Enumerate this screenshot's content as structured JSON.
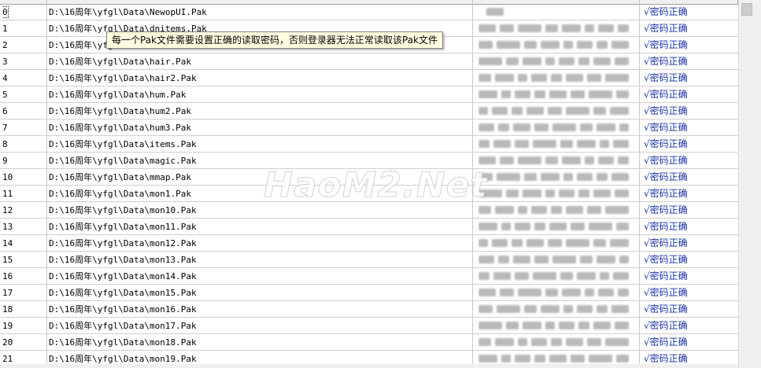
{
  "list": {
    "rows": [
      {
        "index": "0",
        "path": "D:\\16周年\\yfgl\\Data\\NewopUI.Pak",
        "status": "√密码正确"
      },
      {
        "index": "1",
        "path": "D:\\16周年\\yfgl\\Data\\dnitems.Pak",
        "status": "√密码正确"
      },
      {
        "index": "2",
        "path": "D:\\16周年\\yfgl\\Data\\effect.Pak",
        "status": "√密码正确"
      },
      {
        "index": "3",
        "path": "D:\\16周年\\yfgl\\Data\\hair.Pak",
        "status": "√密码正确"
      },
      {
        "index": "4",
        "path": "D:\\16周年\\yfgl\\Data\\hair2.Pak",
        "status": "√密码正确"
      },
      {
        "index": "5",
        "path": "D:\\16周年\\yfgl\\Data\\hum.Pak",
        "status": "√密码正确"
      },
      {
        "index": "6",
        "path": "D:\\16周年\\yfgl\\Data\\hum2.Pak",
        "status": "√密码正确"
      },
      {
        "index": "7",
        "path": "D:\\16周年\\yfgl\\Data\\hum3.Pak",
        "status": "√密码正确"
      },
      {
        "index": "8",
        "path": "D:\\16周年\\yfgl\\Data\\items.Pak",
        "status": "√密码正确"
      },
      {
        "index": "9",
        "path": "D:\\16周年\\yfgl\\Data\\magic.Pak",
        "status": "√密码正确"
      },
      {
        "index": "10",
        "path": "D:\\16周年\\yfgl\\Data\\mmap.Pak",
        "status": "√密码正确"
      },
      {
        "index": "11",
        "path": "D:\\16周年\\yfgl\\Data\\mon1.Pak",
        "status": "√密码正确"
      },
      {
        "index": "12",
        "path": "D:\\16周年\\yfgl\\Data\\mon10.Pak",
        "status": "√密码正确"
      },
      {
        "index": "13",
        "path": "D:\\16周年\\yfgl\\Data\\mon11.Pak",
        "status": "√密码正确"
      },
      {
        "index": "14",
        "path": "D:\\16周年\\yfgl\\Data\\mon12.Pak",
        "status": "√密码正确"
      },
      {
        "index": "15",
        "path": "D:\\16周年\\yfgl\\Data\\mon13.Pak",
        "status": "√密码正确"
      },
      {
        "index": "16",
        "path": "D:\\16周年\\yfgl\\Data\\mon14.Pak",
        "status": "√密码正确"
      },
      {
        "index": "17",
        "path": "D:\\16周年\\yfgl\\Data\\mon15.Pak",
        "status": "√密码正确"
      },
      {
        "index": "18",
        "path": "D:\\16周年\\yfgl\\Data\\mon16.Pak",
        "status": "√密码正确"
      },
      {
        "index": "19",
        "path": "D:\\16周年\\yfgl\\Data\\mon17.Pak",
        "status": "√密码正确"
      },
      {
        "index": "20",
        "path": "D:\\16周年\\yfgl\\Data\\mon18.Pak",
        "status": "√密码正确"
      },
      {
        "index": "21",
        "path": "D:\\16周年\\yfgl\\Data\\mon19.Pak",
        "status": "√密码正确"
      }
    ]
  },
  "tooltip": {
    "text": "每一个Pak文件需要设置正确的读取密码，否则登录器无法正常读取该Pak文件"
  },
  "watermark": {
    "text": "HaoM2.Net"
  },
  "colors": {
    "status_text": "#1a33a8",
    "tooltip_bg": "#ffffe1",
    "grid_line": "#cfcfcf"
  }
}
